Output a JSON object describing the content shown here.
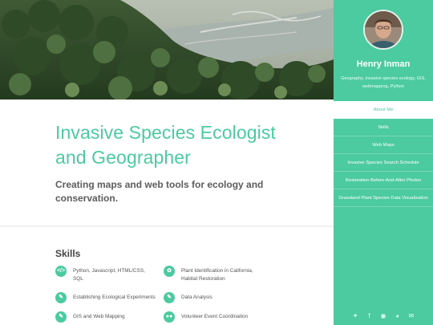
{
  "intro": {
    "headline": "Invasive Species Ecologist and Geographer",
    "subline": "Creating maps and web tools for ecology and conservation."
  },
  "skills": {
    "title": "Skills",
    "items": [
      {
        "label": "Python, Javascript, HTML/CSS, SQL",
        "icon": "code-icon"
      },
      {
        "label": "Plant Identification in California, Habitat Restoration",
        "icon": "leaf-icon"
      },
      {
        "label": "Establishing Ecological Experiments",
        "icon": "pencil-icon"
      },
      {
        "label": "Data Analysis",
        "icon": "pencil-icon"
      },
      {
        "label": "GIS and Web Mapping",
        "icon": "pencil-icon"
      },
      {
        "label": "Volunteer Event Coordination",
        "icon": "group-icon"
      }
    ]
  },
  "sidebar": {
    "name": "Henry Inman",
    "tagline": "Geography, invasive species ecology, GIS, webmapping, Python",
    "nav": [
      {
        "label": "About Me",
        "active": true
      },
      {
        "label": "Skills"
      },
      {
        "label": "Web Maps"
      },
      {
        "label": "Invasive Species Search Schedule"
      },
      {
        "label": "Restoration Before-And-After Photos"
      },
      {
        "label": "Grassland Plant Species Data Visualization"
      }
    ],
    "socials": [
      "twitter-icon",
      "facebook-icon",
      "instagram-icon",
      "github-icon",
      "email-icon"
    ]
  },
  "colors": {
    "accent": "#4ccaa0",
    "text": "#5c5c5c"
  }
}
